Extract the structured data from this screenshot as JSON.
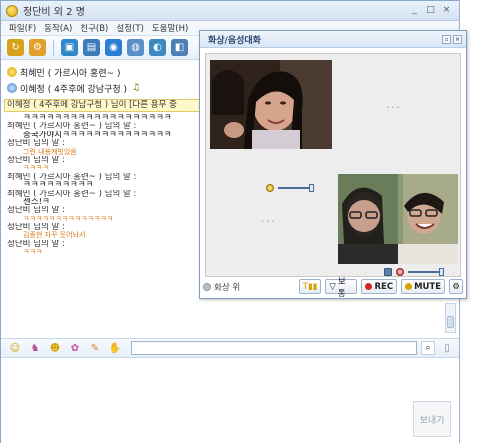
{
  "window": {
    "title": "정단비  외 2 명",
    "controls": [
      "_",
      "□",
      "×"
    ]
  },
  "menu": [
    "파일(F)",
    "동작(A)",
    "친구(B)",
    "설정(T)",
    "도움말(H)"
  ],
  "members": [
    {
      "name": "최혜민 ( 가르시아 홍련~ )",
      "extra": ""
    },
    {
      "name": "이혜정 ( 4주후에 강남구청 )",
      "extra": "♫"
    }
  ],
  "notice": "이혜정 ( 4주후에 강남구청 ) 님이 [다른 용무 중",
  "chat_lines": [
    {
      "type": "msg",
      "text": "ㅋㅋㅋㅋㅋㅋㅋㅋㅋㅋㅋㅋㅋㅋㅋㅋㅋㅋㅋ"
    },
    {
      "type": "spk",
      "text": "최혜민 ( 가르시아 홍련~ ) 님의 말 :"
    },
    {
      "type": "msg",
      "text": "중국가야지ㅋㅋㅋㅋㅋㅋㅋㅋㅋㅋㅋㅋㅋㅋ"
    },
    {
      "type": "spk",
      "text": "정단비 님의 말 :"
    },
    {
      "type": "msg orange",
      "text": "그런 내용캐빗있음"
    },
    {
      "type": "spk",
      "text": "정단비 님의 말 :"
    },
    {
      "type": "msg orange",
      "text": "ㅋㅋㅋㅋ"
    },
    {
      "type": "spk",
      "text": "최혜민 ( 가르시아 홍련~ ) 님의 말 :"
    },
    {
      "type": "msg",
      "text": "ㅋㅋㅋㅋㅋㅋㅋㅋㅋ"
    },
    {
      "type": "spk",
      "text": "최혜민 ( 가르시아 홍련~ ) 님의 말 :"
    },
    {
      "type": "msg",
      "text": "센스!ㅋ"
    },
    {
      "type": "spk",
      "text": "정단비 님의 말 :"
    },
    {
      "type": "msg orange",
      "text": "ㅋㅋㅋㅋㅋㅋㅋㅋㅋㅋㅋㅋㅋㅋ"
    },
    {
      "type": "spk",
      "text": "정단비 님의 말 :"
    },
    {
      "type": "msg orange",
      "text": "김종현 자꾸 웃어놔서"
    },
    {
      "type": "spk",
      "text": "정단비 님의 말 :"
    },
    {
      "type": "msg orange",
      "text": "ㅋㅋㅋ"
    }
  ],
  "video": {
    "title": "화상/음성대화",
    "empty_slot": "...",
    "status": "화상 위",
    "buttons": {
      "voice": "보통",
      "rec": "REC",
      "mute": "MUTE"
    }
  },
  "send_label": "보내기",
  "colors": {
    "accent": "#2b4a70",
    "orange_text": "#d9791b",
    "rec": "#d8251f"
  }
}
